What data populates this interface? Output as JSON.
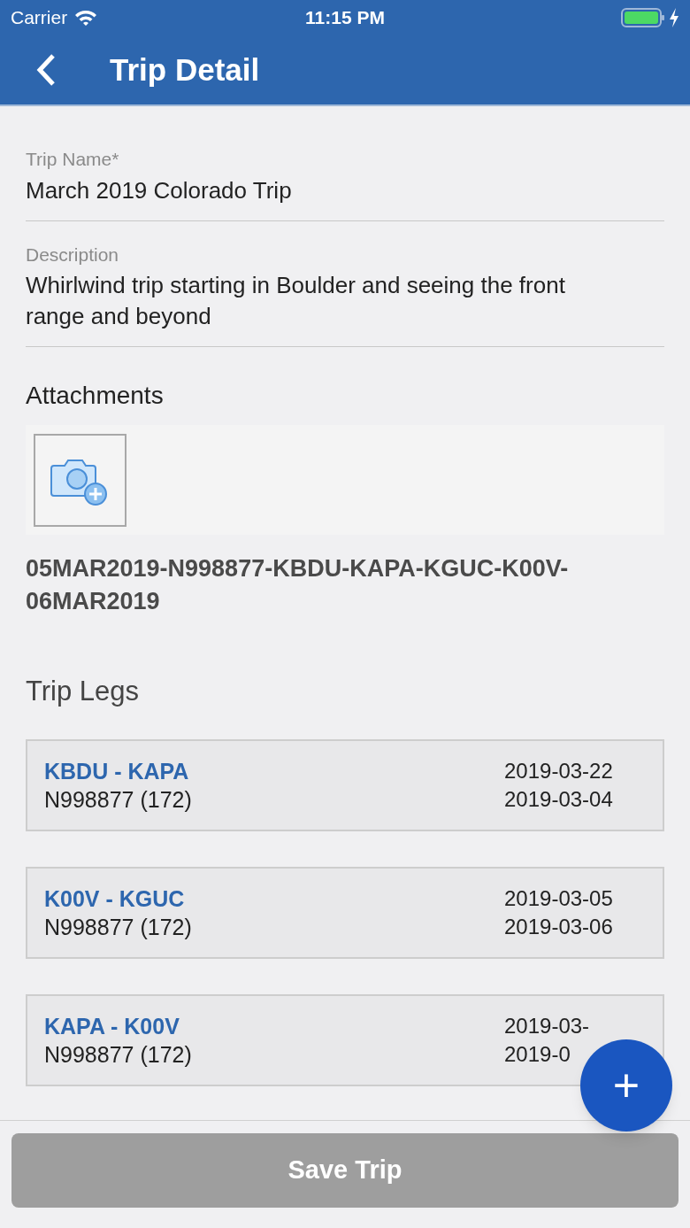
{
  "status_bar": {
    "carrier": "Carrier",
    "time": "11:15 PM"
  },
  "nav": {
    "title": "Trip Detail"
  },
  "fields": [
    {
      "label": "Trip Name*",
      "value": "March 2019 Colorado Trip"
    },
    {
      "label": "Description",
      "value": "Whirlwind trip starting in Boulder and seeing the front range and beyond"
    }
  ],
  "attachments": {
    "title": "Attachments",
    "filename": "05MAR2019-N998877-KBDU-KAPA-KGUC-K00V-06MAR2019"
  },
  "trip_legs": {
    "title": "Trip Legs",
    "legs": [
      {
        "route": "KBDU - KAPA",
        "aircraft": "N998877 (172)",
        "date_1": "2019-03-22",
        "date_2": "2019-03-04"
      },
      {
        "route": "K00V - KGUC",
        "aircraft": "N998877 (172)",
        "date_1": "2019-03-05",
        "date_2": "2019-03-06"
      },
      {
        "route": "KAPA - K00V",
        "aircraft": "N998877 (172)",
        "date_1": "2019-03-",
        "date_2": "2019-0"
      }
    ]
  },
  "fab": {
    "label": "+"
  },
  "save_button": {
    "label": "Save Trip",
    "disabled": true
  }
}
